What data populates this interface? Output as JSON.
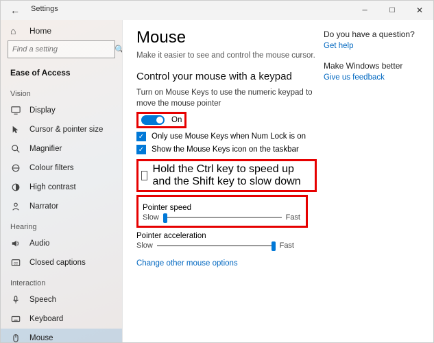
{
  "titlebar": {
    "title": "Settings"
  },
  "sidebar": {
    "home": "Home",
    "search_placeholder": "Find a setting",
    "category": "Ease of Access",
    "groups": [
      {
        "header": "Vision",
        "items": [
          {
            "name": "display",
            "label": "Display"
          },
          {
            "name": "cursor",
            "label": "Cursor & pointer size"
          },
          {
            "name": "magnifier",
            "label": "Magnifier"
          },
          {
            "name": "colour-filters",
            "label": "Colour filters"
          },
          {
            "name": "high-contrast",
            "label": "High contrast"
          },
          {
            "name": "narrator",
            "label": "Narrator"
          }
        ]
      },
      {
        "header": "Hearing",
        "items": [
          {
            "name": "audio",
            "label": "Audio"
          },
          {
            "name": "closed-captions",
            "label": "Closed captions"
          }
        ]
      },
      {
        "header": "Interaction",
        "items": [
          {
            "name": "speech",
            "label": "Speech"
          },
          {
            "name": "keyboard",
            "label": "Keyboard"
          },
          {
            "name": "mouse",
            "label": "Mouse",
            "selected": true
          }
        ]
      }
    ]
  },
  "page": {
    "title": "Mouse",
    "subtitle": "Make it easier to see and control the mouse cursor.",
    "section_title": "Control your mouse with a keypad",
    "description": "Turn on Mouse Keys to use the numeric keypad to move the mouse pointer",
    "toggle_label": "On",
    "cb1": "Only use Mouse Keys when Num Lock is on",
    "cb2": "Show the Mouse Keys icon on the taskbar",
    "cb3": "Hold the Ctrl key to speed up and the Shift key to slow down",
    "slider1_title": "Pointer speed",
    "slider2_title": "Pointer acceleration",
    "slider_slow": "Slow",
    "slider_fast": "Fast",
    "other_link": "Change other mouse options"
  },
  "aside": {
    "q": "Do you have a question?",
    "help": "Get help",
    "better": "Make Windows better",
    "feedback": "Give us feedback"
  }
}
